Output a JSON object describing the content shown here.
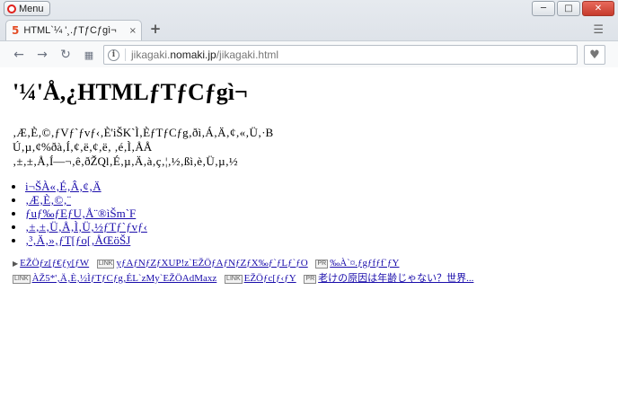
{
  "browser": {
    "menu_label": "Menu",
    "tab_title": "HTML`¼ '¸.ƒTƒCƒgì¬",
    "tab_close": "×",
    "new_tab": "+",
    "url_host": "jikagaki.nomaki.jp",
    "url_path": "/jikagaki.html",
    "url_prefix": "jikagaki.",
    "url_domain": "nomaki.jp",
    "controls": {
      "minimize": "─",
      "maximize": "□",
      "close": "✕"
    }
  },
  "page": {
    "heading": "'¼'Å,¿HTMLƒTƒCƒgì¬",
    "paragraph_lines": [
      "‚Æ‚È‚©‚ƒVƒ`ƒvƒ‹‚È'iŠK`Ì‚ÈƒTƒCƒg‚ðì‚Á‚Ä‚¢‚«‚Ü‚·B",
      "Ú‚µ‚¢%ðà‚Í‚¢‚ë‚¢‚ë‚ ‚é‚Ì‚ÅÅ",
      "‚±‚±‚Å‚Í—¬‚ê‚ðŽQl‚É‚µ‚Ä‚à‚ç‚¦‚½‚ßì‚è‚Ü‚µ‚½"
    ],
    "links": [
      "i¬ŠÀ«‚É‚Â‚¢‚Ä",
      "‚Æ‚È‚©‚¨",
      "ƒuƒ‰ƒEƒU‚Å¨®ìŠm`F",
      "‚±‚±‚Ü‚Å‚Ì‚Ü‚½ƒTƒ`ƒvƒ‹",
      "‚³‚Ä‚»‚ƒT[ƒo[‚ÅŒöŠJ"
    ],
    "ads": [
      {
        "badge": "▶",
        "text": "EŽÖƒz[ƒ€ƒy[ƒW"
      },
      {
        "badge": "LINK",
        "text": "yƒAƒNƒZƒXUP!z`EŽÖƒAƒNƒZƒX‰ƒ`ƒLƒ`ƒO"
      },
      {
        "badge": "PR",
        "text": "‰À`¤.ƒgƒfƒf`ƒY"
      },
      {
        "badge": "LINK",
        "text": "ÀŽ5*'‚Ä‚È‚½ÌƒTƒCƒg‚ÉL`zMy`EŽÖAdMaxz"
      },
      {
        "badge": "LINK",
        "text": "EŽÖƒc[ƒ‹ƒY"
      },
      {
        "badge": "PR",
        "text": "老けの原因は年齢じゃない？世界..."
      }
    ]
  }
}
